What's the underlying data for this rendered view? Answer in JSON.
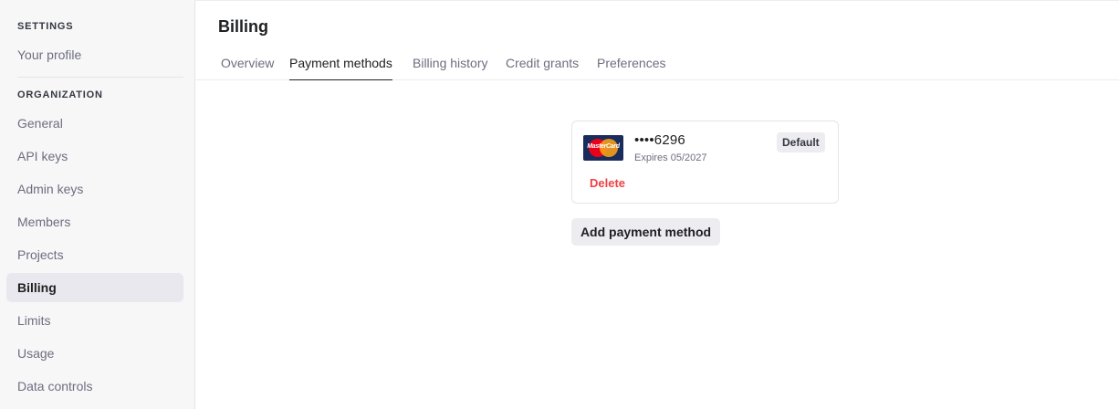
{
  "sidebar": {
    "settings_title": "SETTINGS",
    "your_profile": "Your profile",
    "organization_title": "ORGANIZATION",
    "items": [
      {
        "label": "General"
      },
      {
        "label": "API keys"
      },
      {
        "label": "Admin keys"
      },
      {
        "label": "Members"
      },
      {
        "label": "Projects"
      },
      {
        "label": "Billing"
      },
      {
        "label": "Limits"
      },
      {
        "label": "Usage"
      },
      {
        "label": "Data controls"
      }
    ],
    "active_item": "Billing"
  },
  "main": {
    "title": "Billing",
    "tabs": [
      {
        "label": "Overview"
      },
      {
        "label": "Payment methods"
      },
      {
        "label": "Billing history"
      },
      {
        "label": "Credit grants"
      },
      {
        "label": "Preferences"
      }
    ],
    "active_tab": "Payment methods"
  },
  "payment_method": {
    "brand": "MasterCard",
    "brand_icon": "mastercard-logo-icon",
    "number": "••••6296",
    "expiry": "Expires 05/2027",
    "default_badge": "Default",
    "delete_label": "Delete"
  },
  "add_button_label": "Add payment method",
  "colors": {
    "delete": "#ef4146",
    "active_bg": "#e8e8ee",
    "card_bg": "#1a2c5b"
  }
}
